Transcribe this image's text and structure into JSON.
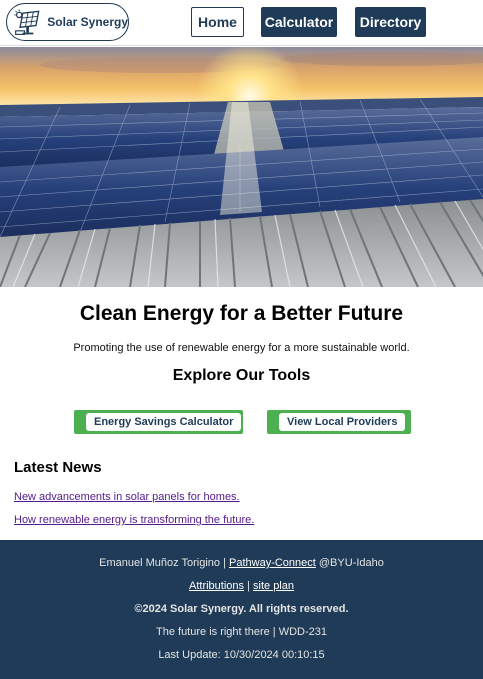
{
  "header": {
    "logo_text": "Solar Synergy",
    "nav": {
      "home": "Home",
      "calculator": "Calculator",
      "directory": "Directory"
    }
  },
  "main": {
    "title": "Clean Energy for a Better Future",
    "subtitle": "Promoting the use of renewable energy for a more sustainable world.",
    "tools_heading": "Explore Our Tools",
    "tools": {
      "calculator_label": "Energy Savings Calculator",
      "providers_label": "View Local Providers"
    },
    "news": {
      "heading": "Latest News",
      "items": [
        "New advancements in solar panels for homes.",
        "How renewable energy is transforming the future."
      ]
    }
  },
  "footer": {
    "author": "Emanuel Muñoz Torigino",
    "sep1": " | ",
    "pathway_link": "Pathway-Connect",
    "school": " @BYU-Idaho",
    "attributions_link": "Attributions",
    "sep2": " | ",
    "siteplan_link": "site plan",
    "copyright": "©2024 Solar Synergy. All rights reserved.",
    "tagline": "The future is right there | WDD-231",
    "last_update": "Last Update: 10/30/2024 00:10:15"
  },
  "colors": {
    "navy": "#1f3b57",
    "accent_green": "#4caf50",
    "visited_link": "#551a8b"
  },
  "icons": {
    "logo": "solar-panel-icon"
  }
}
